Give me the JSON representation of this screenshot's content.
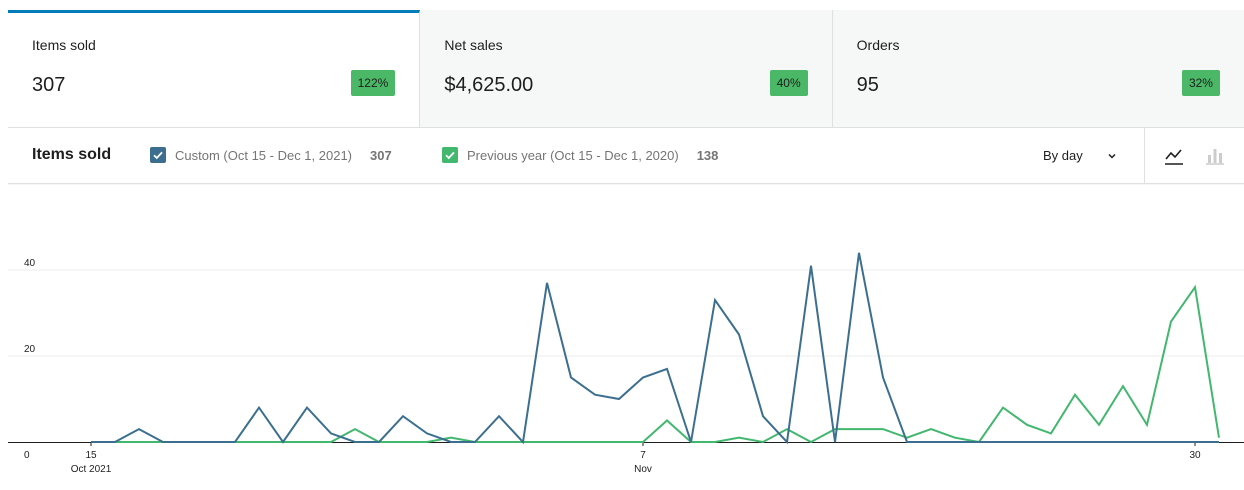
{
  "summary": {
    "tiles": [
      {
        "label": "Items sold",
        "value": "307",
        "delta": "122%"
      },
      {
        "label": "Net sales",
        "value": "$4,625.00",
        "delta": "40%"
      },
      {
        "label": "Orders",
        "value": "95",
        "delta": "32%"
      }
    ]
  },
  "chart_header": {
    "title": "Items sold",
    "legend": [
      {
        "label": "Custom (Oct 15 - Dec 1, 2021)",
        "total": "307",
        "color": "#3c6f8f"
      },
      {
        "label": "Previous year (Oct 15 - Dec 1, 2020)",
        "total": "138",
        "color": "#42b76e"
      }
    ],
    "interval_label": "By day",
    "chart_type_icons": [
      "line-chart-icon",
      "bar-chart-icon"
    ]
  },
  "colors": {
    "accent": "#007cba",
    "delta_badge": "#4ab866",
    "current": "#3c6f8f",
    "previous": "#42b76e"
  },
  "chart_data": {
    "type": "line",
    "title": "",
    "xlabel": "",
    "ylabel": "",
    "ylim": [
      0,
      60
    ],
    "yticks": [
      0,
      20,
      40,
      60
    ],
    "grid": true,
    "x": [
      "2021-10-15",
      "2021-10-16",
      "2021-10-17",
      "2021-10-18",
      "2021-10-19",
      "2021-10-20",
      "2021-10-21",
      "2021-10-22",
      "2021-10-23",
      "2021-10-24",
      "2021-10-25",
      "2021-10-26",
      "2021-10-27",
      "2021-10-28",
      "2021-10-29",
      "2021-10-30",
      "2021-10-31",
      "2021-11-01",
      "2021-11-02",
      "2021-11-03",
      "2021-11-04",
      "2021-11-05",
      "2021-11-06",
      "2021-11-07",
      "2021-11-08",
      "2021-11-09",
      "2021-11-10",
      "2021-11-11",
      "2021-11-12",
      "2021-11-13",
      "2021-11-14",
      "2021-11-15",
      "2021-11-16",
      "2021-11-17",
      "2021-11-18",
      "2021-11-19",
      "2021-11-20",
      "2021-11-21",
      "2021-11-22",
      "2021-11-23",
      "2021-11-24",
      "2021-11-25",
      "2021-11-26",
      "2021-11-27",
      "2021-11-28",
      "2021-11-29",
      "2021-11-30",
      "2021-12-01"
    ],
    "x_ticks": [
      {
        "index": 0,
        "label": "15",
        "sublabel": "Oct 2021"
      },
      {
        "index": 23,
        "label": "7",
        "sublabel": "Nov"
      },
      {
        "index": 46,
        "label": "30",
        "sublabel": ""
      }
    ],
    "series": [
      {
        "name": "Custom (Oct 15 - Dec 1, 2021)",
        "color": "#3c6f8f",
        "values": [
          0,
          0,
          3,
          0,
          0,
          0,
          0,
          8,
          0,
          8,
          2,
          0,
          0,
          6,
          2,
          0,
          0,
          6,
          0,
          37,
          15,
          11,
          10,
          15,
          17,
          0,
          33,
          25,
          6,
          0,
          41,
          0,
          44,
          15,
          0,
          0,
          0,
          0,
          0,
          0,
          0,
          0,
          0,
          0,
          0,
          0,
          0,
          0
        ]
      },
      {
        "name": "Previous year (Oct 15 - Dec 1, 2020)",
        "color": "#42b76e",
        "values": [
          0,
          0,
          0,
          0,
          0,
          0,
          0,
          0,
          0,
          0,
          0,
          3,
          0,
          0,
          0,
          1,
          0,
          0,
          0,
          0,
          0,
          0,
          0,
          0,
          5,
          0,
          0,
          1,
          0,
          3,
          0,
          3,
          3,
          3,
          1,
          3,
          1,
          0,
          8,
          4,
          2,
          11,
          4,
          13,
          4,
          28,
          36,
          1
        ]
      }
    ]
  }
}
